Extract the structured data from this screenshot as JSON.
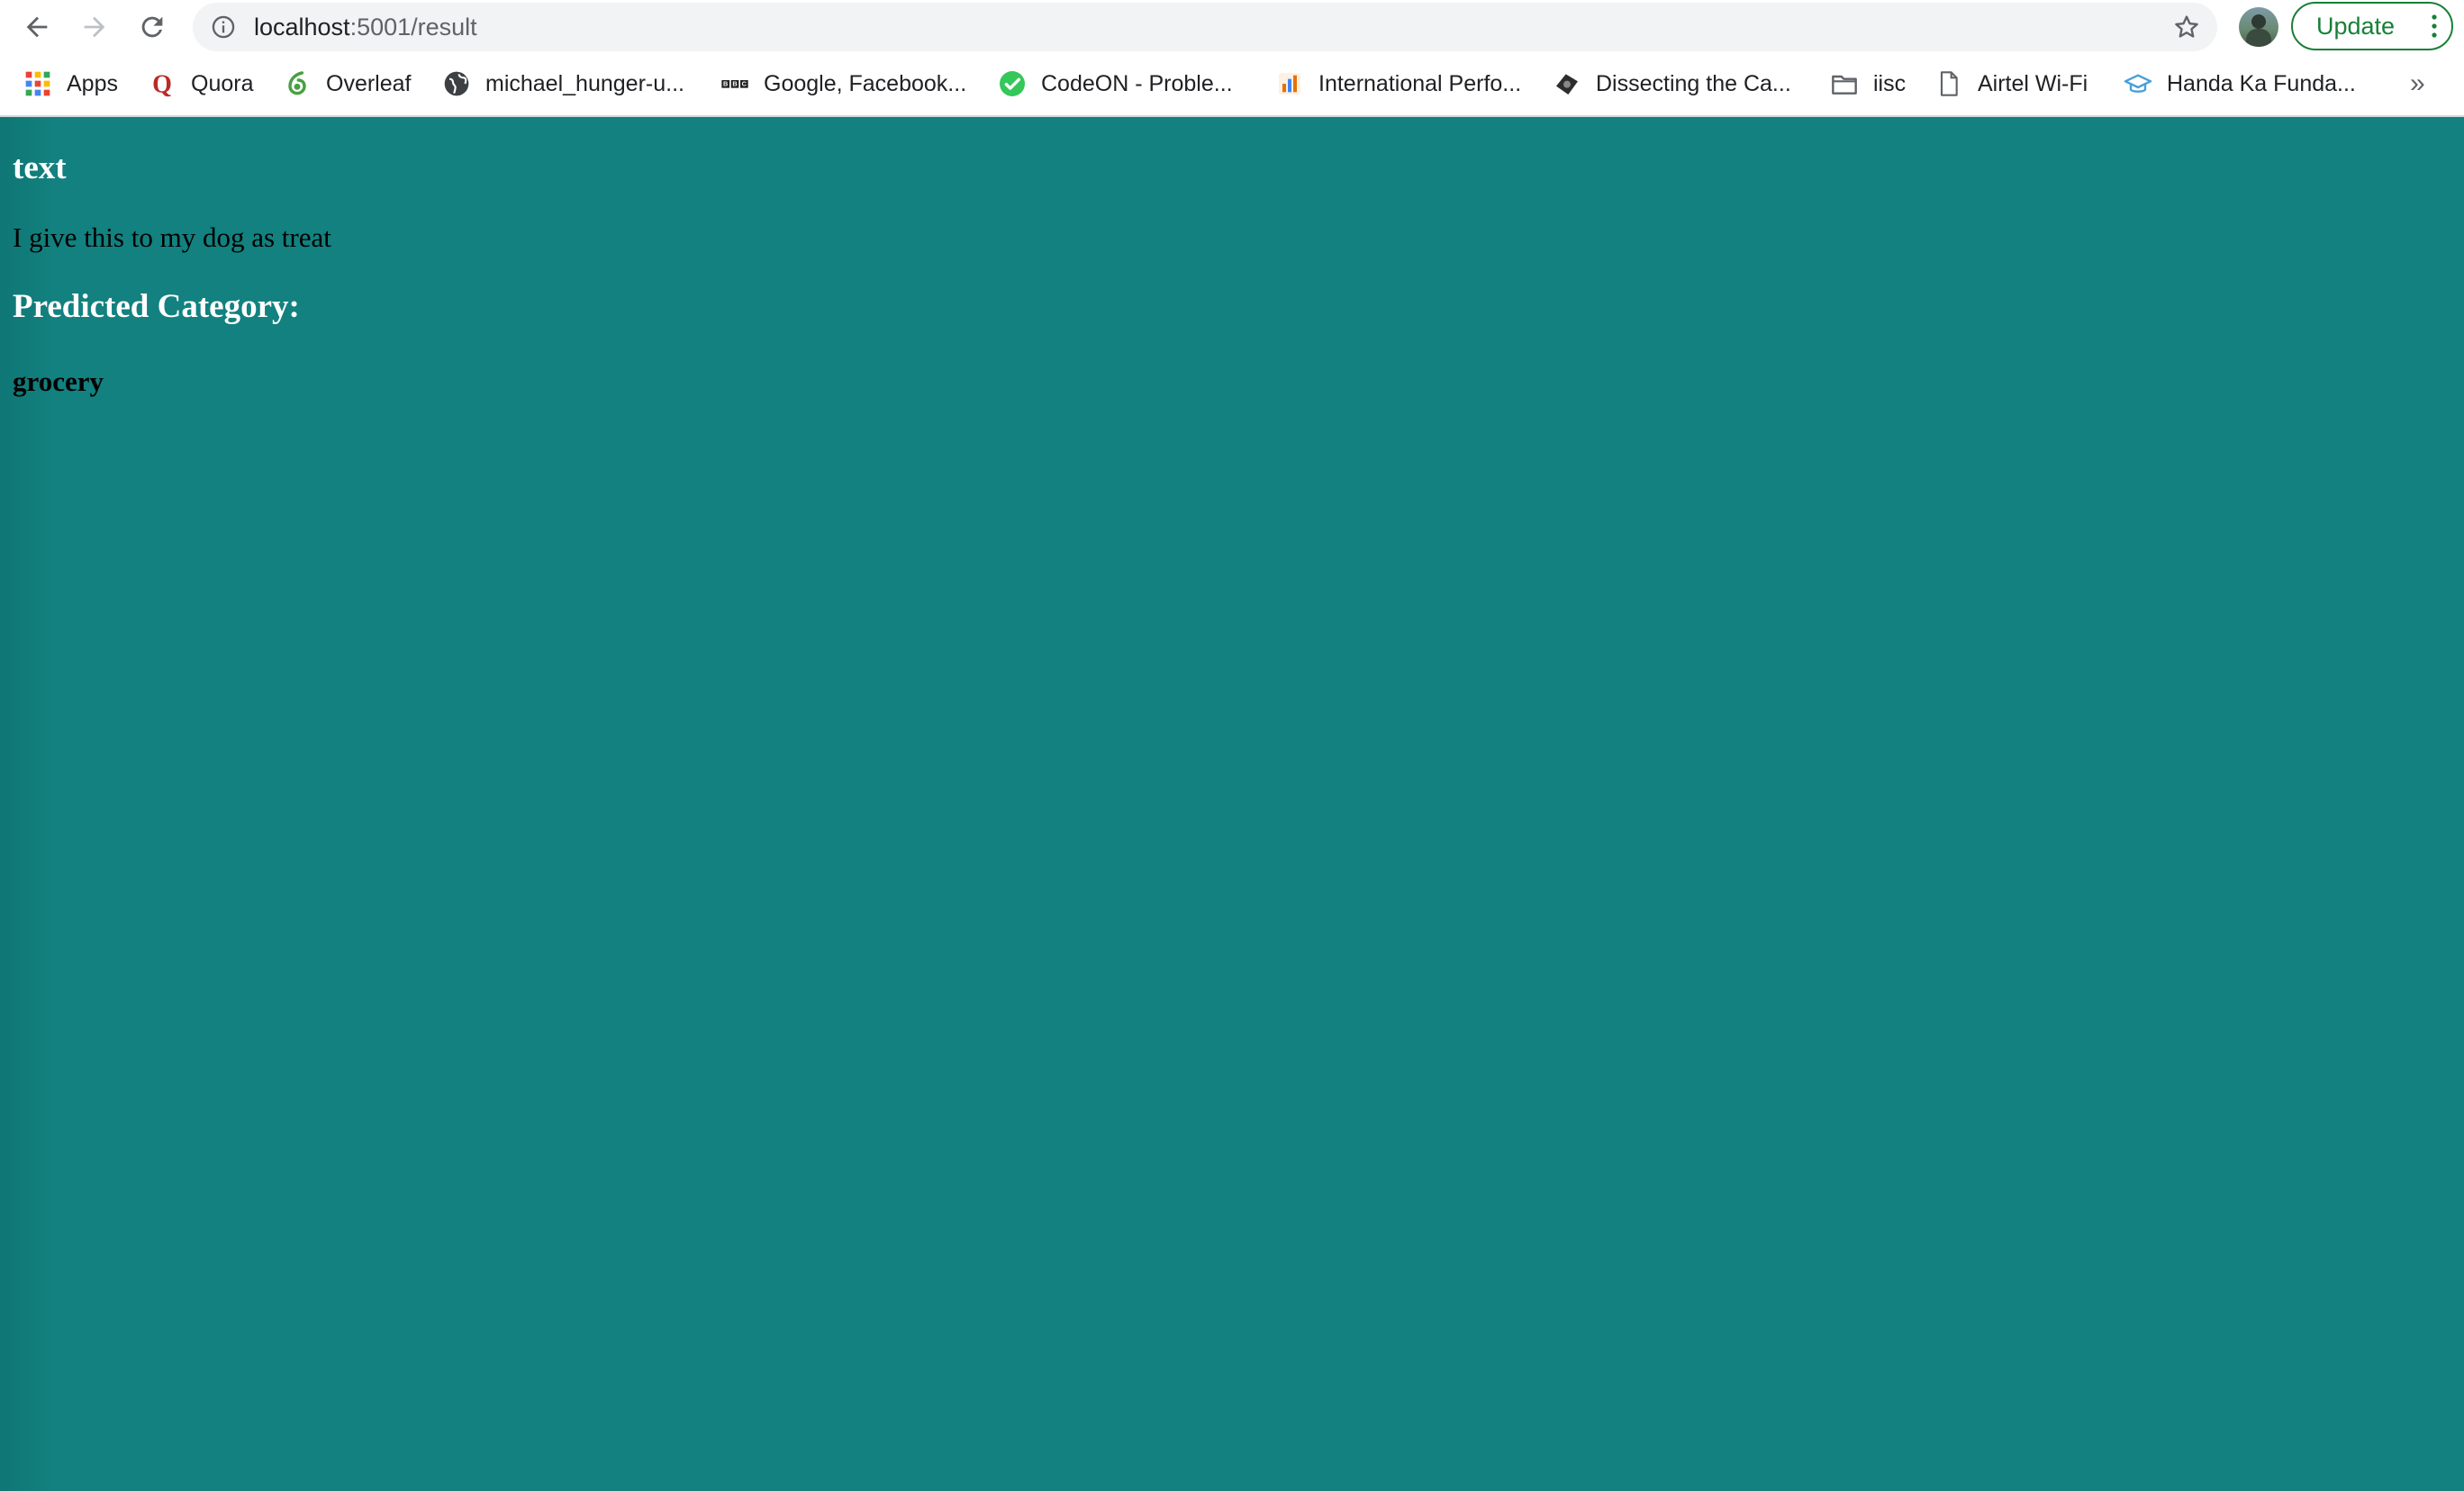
{
  "browser": {
    "url_host": "localhost",
    "url_path": ":5001/result",
    "update_label": "Update",
    "accent_color": "#188038"
  },
  "bookmarks": [
    {
      "label": "Apps",
      "icon": "apps-grid-icon"
    },
    {
      "label": "Quora",
      "icon": "quora-icon"
    },
    {
      "label": "Overleaf",
      "icon": "overleaf-icon"
    },
    {
      "label": "michael_hunger-u...",
      "icon": "globe-icon"
    },
    {
      "label": "Google, Facebook...",
      "icon": "bbc-icon"
    },
    {
      "label": "CodeON - Proble...",
      "icon": "check-circle-icon"
    },
    {
      "label": "International Perfo...",
      "icon": "chart-icon"
    },
    {
      "label": "Dissecting the Ca...",
      "icon": "camera-icon"
    },
    {
      "label": "iisc",
      "icon": "folder-icon"
    },
    {
      "label": "Airtel Wi-Fi",
      "icon": "page-icon"
    },
    {
      "label": "Handa Ka Funda...",
      "icon": "graduation-cap-icon"
    }
  ],
  "page": {
    "heading": "text",
    "input_text": "I give this to my dog as treat",
    "prediction_heading": "Predicted Category:",
    "prediction": "grocery",
    "background_color": "#12817f"
  }
}
